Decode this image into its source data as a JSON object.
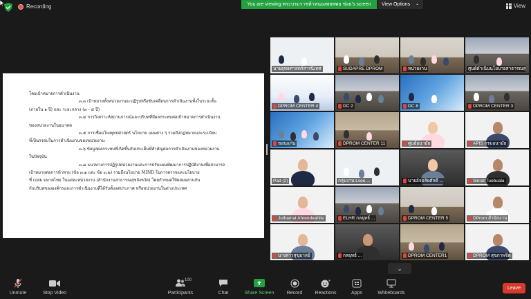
{
  "topbar": {
    "recording_label": "Recording",
    "viewing_banner": "You are viewing พระบรมราชท้าหนองพยพพย ช่อย's screen",
    "view_options_label": "View Options",
    "view_label": "View",
    "colors": {
      "banner": "#23a140",
      "recording_dot": "#e4554b",
      "shield": "#23a140"
    }
  },
  "document": {
    "lines": [
      "โดยเป้าหมายการดำเนินงาน",
      "๓.๓ เป้าหมายทั้งหน่วยงานจะปฏิรูปหรือขับเคลื่อนการดำเนินงานทั้งในระยะสั้น",
      "(ภายใน ๑ ปี) และ ระยะกลาง (๓ - ๕ ปี)",
      "๓.๔ การวิเคราะห์สถานการณ์และบริบทที่มีผลกระทบต่อเป้าหมายการดำเนินงาน",
      "ของหน่วยงานในอนาคต",
      "๓.๕ การเชื่อมโยงยุทธศาสตร์ นโยบาย แผนต่าง ๆ รวมถึงกฎหมายและระเบียบ",
      "ที่เป็นกรอบในการดำเนินงานของหน่วยงาน",
      "๓.๖ ข้อมูลผลกระทบที่เกิดขึ้นกับประเด็นที่สำคัญต่อการดำเนินงานของหน่วยงาน",
      "ในปัจจุบัน",
      "๓.๗ แนวทางการปฏิรูปหน่วยงานและการปรับแผนพัฒนาการปฏิบัติงานเพื่อสามารถ",
      "เป้าหมายต่อการท้าทาย (ข้อ ๓.๑ และ ข้อ ๓.๒) รวมถึงนโยบาย MIND ในการตรวจและนโยบาย",
      "ที่ เปลย มหาดไทย ในแต่ละหน่วยงาน (สำนักงานสาธารณสุขจังหวัด) โดยกำหนดให้ผสมผสานกัน",
      "กับบริบทขององค์กรและการดำเนินงานที่ได้รับตั้งแต่ประกาศ หรือหน่วยงานในต่างประเทศ"
    ]
  },
  "gallery": {
    "tiles": [
      {
        "name": "นายยุทธศาสตร์สารนิเทศ",
        "muted": false,
        "scene": "s-slide",
        "active": true
      },
      {
        "name": "SUDAPRE DPROM",
        "muted": true,
        "scene": "s-office",
        "active": false
      },
      {
        "name": "หน่วยงาน",
        "muted": true,
        "scene": "s-office",
        "active": false
      },
      {
        "name": "ศูนย์ดำเนินนโยบายสาธารณสุข",
        "muted": false,
        "scene": "s-room",
        "active": false
      },
      {
        "name": "DPROM CENTER 4",
        "muted": true,
        "scene": "s-banner",
        "active": false
      },
      {
        "name": "DC 2",
        "muted": true,
        "scene": "s-room",
        "active": false
      },
      {
        "name": "DC 8",
        "muted": true,
        "scene": "s-blue",
        "active": false
      },
      {
        "name": "DPROM CENTER 3",
        "muted": true,
        "scene": "s-room",
        "active": false
      },
      {
        "name": "ขอนแก่น",
        "muted": true,
        "scene": "s-blue",
        "active": false
      },
      {
        "name": "DPROM CENTER 11",
        "muted": true,
        "scene": "s-hall",
        "active": false
      },
      {
        "name": "ศูนย์อนามัย",
        "muted": true,
        "scene": "s-white",
        "active": false
      },
      {
        "name": "APIS กรมอนามัย",
        "muted": true,
        "scene": "s-white",
        "active": false
      },
      {
        "name": "Pad (2)",
        "muted": false,
        "scene": "s-white",
        "active": false
      },
      {
        "name": "กลุ่มงาน Lvee ...",
        "muted": false,
        "scene": "s-slide",
        "active": false
      },
      {
        "name": "นายอัจฉริยศักดิ์ ...",
        "muted": true,
        "scene": "s-dark",
        "active": false
      },
      {
        "name": "Sirirat Tuobuala",
        "muted": true,
        "scene": "s-white",
        "active": false
      },
      {
        "name": "Juthamat Ahrendeahile",
        "muted": true,
        "scene": "s-white",
        "active": false
      },
      {
        "name": "ELHR กลยุทธ์ ...",
        "muted": true,
        "scene": "s-room",
        "active": false
      },
      {
        "name": "DPROM CENTER 5",
        "muted": true,
        "scene": "s-office",
        "active": false
      },
      {
        "name": "DProm สำนักงาน",
        "muted": true,
        "scene": "s-white",
        "active": false
      },
      {
        "name": "นางสาวสุขุมาลย์",
        "muted": true,
        "scene": "s-white",
        "active": false
      },
      {
        "name": "กลยุทธ์ ...",
        "muted": true,
        "scene": "s-dark",
        "active": false
      },
      {
        "name": "DPROM CENTER1",
        "muted": true,
        "scene": "s-hall",
        "active": false
      },
      {
        "name": "DPROM สุขภาพจิต",
        "muted": true,
        "scene": "s-white",
        "active": false
      }
    ]
  },
  "toolbar": {
    "unmute": "Unmute",
    "stop_video": "Stop Video",
    "participants": "Participants",
    "participants_count": "100",
    "chat": "Chat",
    "share_screen": "Share Screen",
    "record": "Record",
    "reactions": "Reactions",
    "apps": "Apps",
    "whiteboards": "Whiteboards",
    "leave": "Leave",
    "colors": {
      "leave": "#d63a2c",
      "share": "#23a140"
    }
  }
}
